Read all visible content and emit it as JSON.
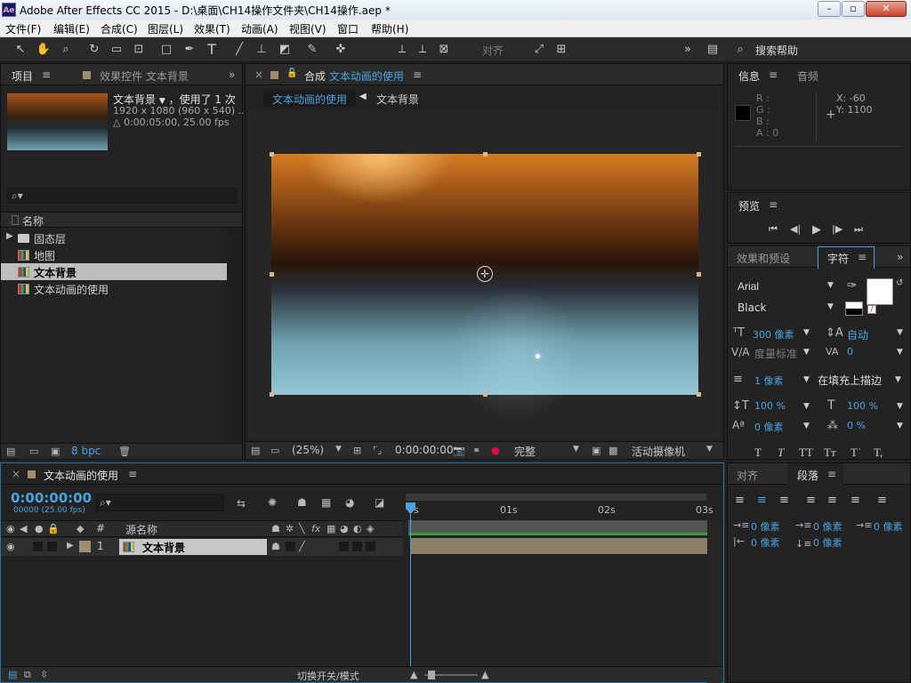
{
  "window": {
    "title": "Adobe After Effects CC 2015 - D:\\桌面\\CH14操作文件夹\\CH14操作.aep *",
    "logo": "Ae",
    "min": "–",
    "max": "▫",
    "close": "✕"
  },
  "menu": [
    "文件(F)",
    "编辑(E)",
    "合成(C)",
    "图层(L)",
    "效果(T)",
    "动画(A)",
    "视图(V)",
    "窗口",
    "帮助(H)"
  ],
  "toolbar": {
    "snap_label": "对齐",
    "search_placeholder": "搜索帮助"
  },
  "project": {
    "tab_project": "项目",
    "tab_effects": "效果控件 文本背景",
    "selected_name": "文本背景",
    "used": "，使用了 1 次",
    "dimensions": "1920 x 1080  (960 x 540) ...",
    "duration": "△ 0:00:05:00, 25.00 fps",
    "col_name": "名称",
    "items": [
      {
        "name": "固态层",
        "type": "folder"
      },
      {
        "name": "地图",
        "type": "comp"
      },
      {
        "name": "文本背景",
        "type": "comp",
        "selected": true
      },
      {
        "name": "文本动画的使用",
        "type": "comp"
      }
    ],
    "bpc": "8 bpc"
  },
  "composition": {
    "tab_prefix": "合成",
    "tab_name": "文本动画的使用",
    "breadcrumb_active": "文本动画的使用",
    "breadcrumb_next": "文本背景",
    "zoom": "(25%)",
    "timecode": "0:00:00:00",
    "resolution": "完整",
    "camera": "活动摄像机"
  },
  "info": {
    "tab_info": "信息",
    "tab_audio": "音频",
    "r": "R :",
    "g": "G :",
    "b": "B :",
    "a": "A : 0",
    "x": "X: -60",
    "y": "Y: 1100"
  },
  "preview": {
    "title": "预览"
  },
  "character": {
    "tab_effects": "效果和预设",
    "tab_char": "字符",
    "font": "Arial",
    "style": "Black",
    "size": "300 像素",
    "leading": "自动",
    "kerning": "度量标准",
    "tracking": "0",
    "stroke": "1 像素",
    "stroke_mode": "在填充上描边",
    "vscale": "100 %",
    "hscale": "100 %",
    "baseline": "0 像素",
    "tsume": "0 %"
  },
  "paragraph": {
    "tab_align": "对齐",
    "tab_para": "段落",
    "indent_left": "0 像素",
    "indent_first": "0 像素",
    "indent_right": "0 像素",
    "space_before": "0 像素",
    "space_after": "0 像素"
  },
  "timeline": {
    "tab_name": "文本动画的使用",
    "timecode": "0:00:00:00",
    "fps": "00000 (25.00 fps)",
    "col_source": "源名称",
    "col_num": "#",
    "layer_num": "1",
    "layer_name": "文本背景",
    "ruler": [
      "0s",
      "01s",
      "02s",
      "03s"
    ],
    "toggle_label": "切换开关/模式"
  },
  "colors": {
    "accent": "#4aa3df",
    "panel": "#232323",
    "header": "#2b2b2b"
  }
}
